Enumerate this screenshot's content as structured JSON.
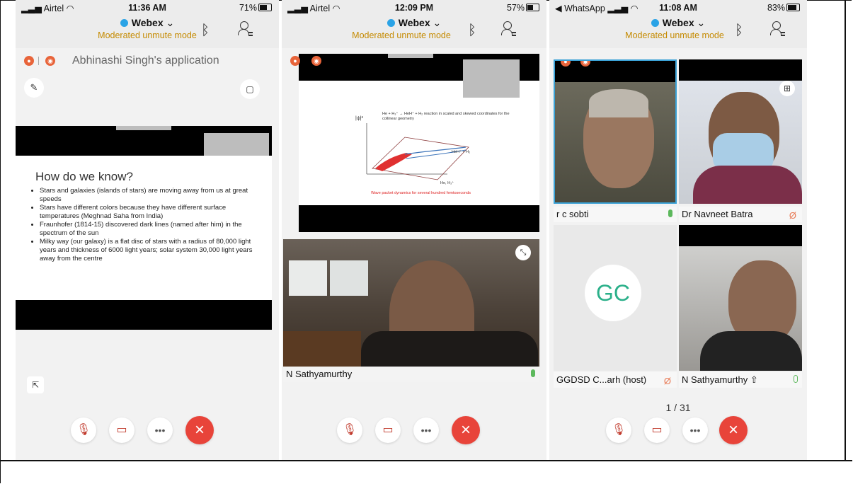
{
  "phones": [
    {
      "status": {
        "carrier": "Airtel",
        "time": "11:36 AM",
        "battery": "71%"
      },
      "app": {
        "title": "Webex",
        "mode": "Moderated unmute mode"
      },
      "share_title": "Abhinashi Singh's application",
      "slide": {
        "heading": "How do we know?",
        "bullets": [
          "Stars and galaxies (islands of stars) are moving away from us at great speeds",
          "Stars have different colors because they have different surface temperatures (Meghnad Saha from India)",
          "Fraunhofer (1814-15) discovered dark lines (named after him) in the spectrum of the sun",
          "Milky way (our galaxy) is a flat disc of stars with a radius of 80,000 light years and thickness of 6000 light years; solar system 30,000 light years away from the centre"
        ]
      }
    },
    {
      "status": {
        "carrier": "Airtel",
        "time": "12:09 PM",
        "battery": "57%"
      },
      "app": {
        "title": "Webex",
        "mode": "Moderated unmute mode"
      },
      "slide": {
        "caption": "He + H₃⁺ → HeH⁺ + H₂ reaction in scaled and skewed coordinates for the collinear geometry",
        "axis_label": "|ψ|²",
        "label_a": "HeH⁺ + H₂",
        "label_b": "He, H₃⁺",
        "footer": "Wave packet dynamics for several hundred femtoseconds"
      },
      "video_name": "N Sathyamurthy"
    },
    {
      "status": {
        "carrier": "WhatsApp",
        "time": "11:08 AM",
        "battery": "83%"
      },
      "app": {
        "title": "Webex",
        "mode": "Moderated unmute mode"
      },
      "tiles": [
        {
          "name": "r c sobti",
          "mic": "on"
        },
        {
          "name": "Dr Navneet Batra",
          "mic": "off"
        },
        {
          "name": "GGDSD C...arh (host)",
          "initials": "GC",
          "mic": "off"
        },
        {
          "name": "N Sathyamurthy",
          "mic": "on"
        }
      ],
      "pager": "1 / 31"
    }
  ],
  "colors": {
    "accent": "#2aa3e6",
    "mode": "#c58a00",
    "end_call": "#e8443a",
    "mic_on": "#5cb85c",
    "initials": "#2bb08a"
  }
}
